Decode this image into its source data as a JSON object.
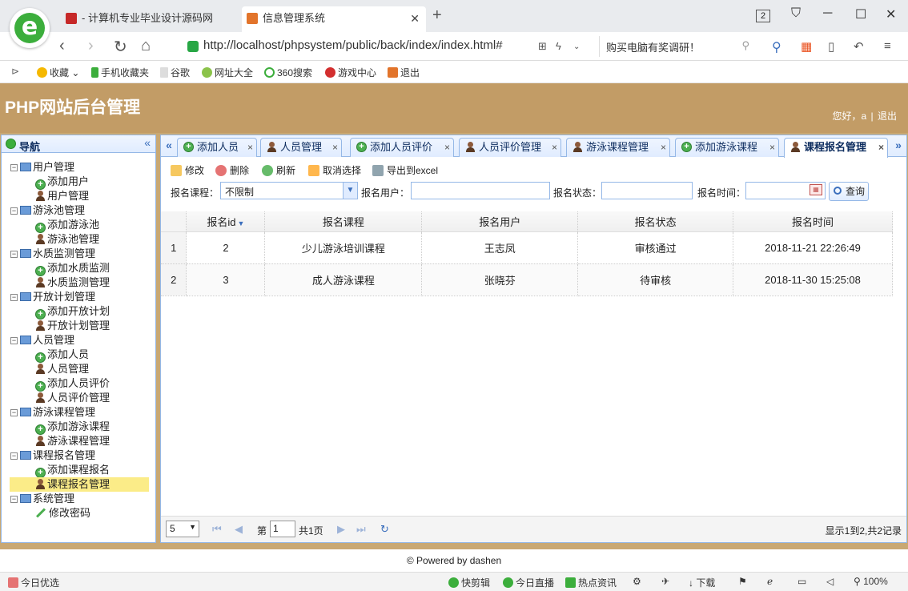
{
  "browser": {
    "tabs": [
      {
        "title": "- 计算机专业毕业设计源码网"
      },
      {
        "title": "信息管理系统"
      }
    ],
    "tab_count": "2",
    "url": "http://localhost/phpsystem/public/back/index/index.html#",
    "search_text": "购买电脑有奖调研！",
    "bookmarks": [
      "收藏",
      "手机收藏夹",
      "谷歌",
      "网址大全",
      "360搜索",
      "游戏中心",
      "退出"
    ]
  },
  "app": {
    "title": "PHP网站后台管理",
    "welcome": "您好，a",
    "logout": "退出"
  },
  "sidebar": {
    "title": "导航",
    "groups": [
      {
        "label": "用户管理",
        "items": [
          "添加用户",
          "用户管理"
        ]
      },
      {
        "label": "游泳池管理",
        "items": [
          "添加游泳池",
          "游泳池管理"
        ]
      },
      {
        "label": "水质监测管理",
        "items": [
          "添加水质监测",
          "水质监测管理"
        ]
      },
      {
        "label": "开放计划管理",
        "items": [
          "添加开放计划",
          "开放计划管理"
        ]
      },
      {
        "label": "人员管理",
        "items": [
          "添加人员",
          "人员管理",
          "添加人员评价",
          "人员评价管理"
        ]
      },
      {
        "label": "游泳课程管理",
        "items": [
          "添加游泳课程",
          "游泳课程管理"
        ]
      },
      {
        "label": "课程报名管理",
        "items": [
          "添加课程报名",
          "课程报名管理"
        ]
      },
      {
        "label": "系统管理",
        "items": [
          "修改密码"
        ]
      }
    ]
  },
  "tabs": [
    "添加人员",
    "人员管理",
    "添加人员评价",
    "人员评价管理",
    "游泳课程管理",
    "添加游泳课程",
    "课程报名管理"
  ],
  "toolbar": {
    "edit": "修改",
    "delete": "删除",
    "refresh": "刷新",
    "cancel_select": "取消选择",
    "export": "导出到excel"
  },
  "filters": {
    "course_label": "报名课程：",
    "course_value": "不限制",
    "user_label": "报名用户：",
    "status_label": "报名状态：",
    "time_label": "报名时间：",
    "query": "查询"
  },
  "grid": {
    "columns": [
      "报名id",
      "报名课程",
      "报名用户",
      "报名状态",
      "报名时间"
    ],
    "rows": [
      {
        "rn": "1",
        "id": "2",
        "course": "少儿游泳培训课程",
        "user": "王志凤",
        "status": "审核通过",
        "time": "2018-11-21 22:26:49"
      },
      {
        "rn": "2",
        "id": "3",
        "course": "成人游泳课程",
        "user": "张晓芬",
        "status": "待审核",
        "time": "2018-11-30 15:25:08"
      }
    ]
  },
  "pager": {
    "page_size": "5",
    "page_prefix": "第",
    "page": "1",
    "page_suffix": "共1页",
    "summary": "显示1到2,共2记录"
  },
  "footer": "© Powered by dashen",
  "statusbar": {
    "left": "今日优选",
    "items": [
      "快剪辑",
      "今日直播",
      "热点资讯",
      "下载"
    ],
    "zoom": "100%"
  },
  "colors": {
    "header": "#c29c66",
    "border": "#95b8e7",
    "selected": "#fbec88"
  }
}
